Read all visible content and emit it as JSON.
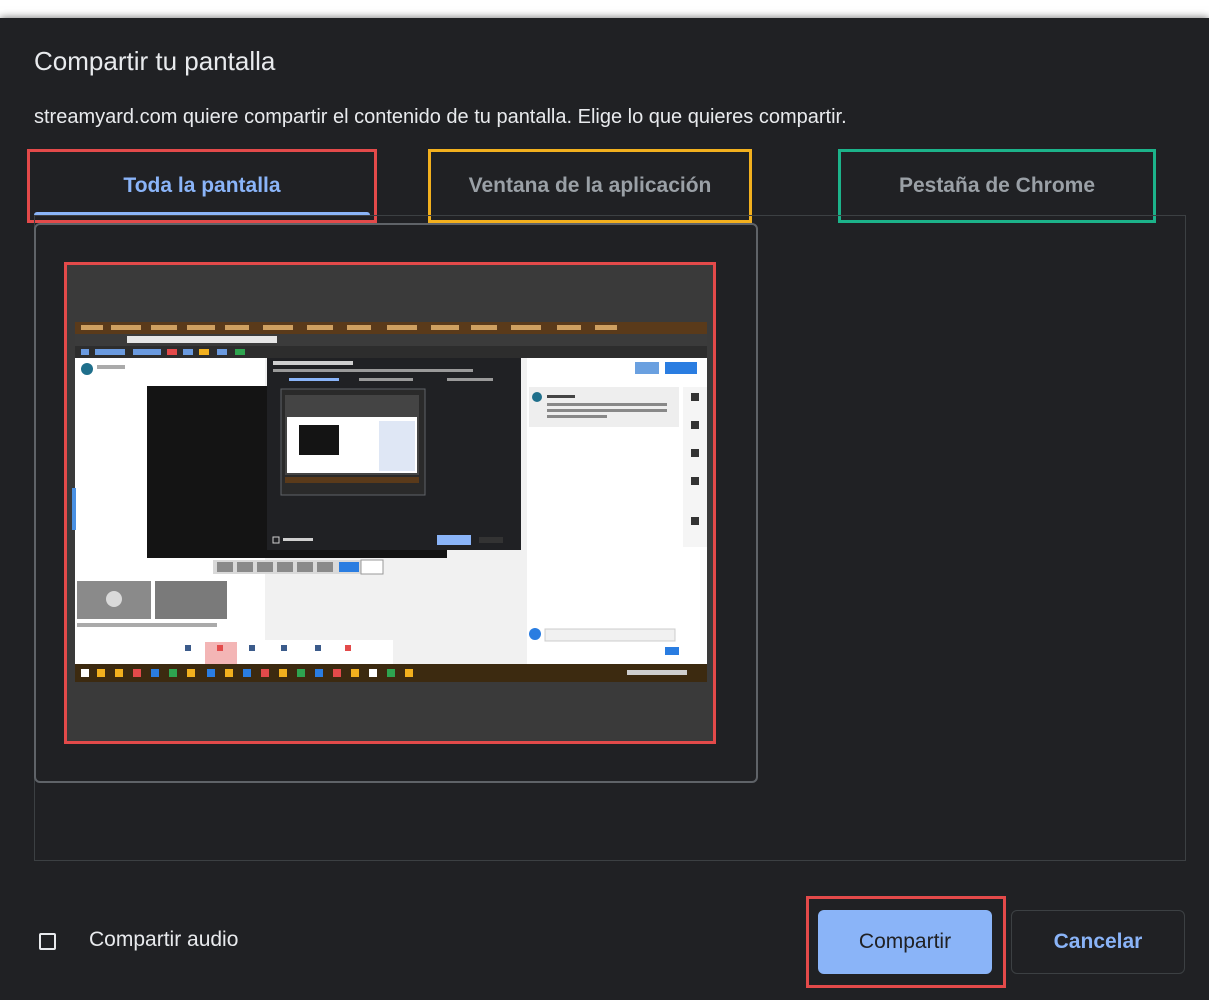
{
  "dialog": {
    "title": "Compartir tu pantalla",
    "subtitle": "streamyard.com quiere compartir el contenido de tu pantalla. Elige lo que quieres compartir."
  },
  "tabs": [
    {
      "label": "Toda la pantalla",
      "active": true
    },
    {
      "label": "Ventana de la aplicación",
      "active": false
    },
    {
      "label": "Pestaña de Chrome",
      "active": false
    }
  ],
  "audio": {
    "label": "Compartir audio",
    "checked": false
  },
  "buttons": {
    "share": "Compartir",
    "cancel": "Cancelar"
  },
  "colors": {
    "background": "#202124",
    "accent": "#8ab4f8",
    "highlight_red": "#e34a4a",
    "highlight_yellow": "#f2b01e",
    "highlight_green": "#1cb38a"
  }
}
